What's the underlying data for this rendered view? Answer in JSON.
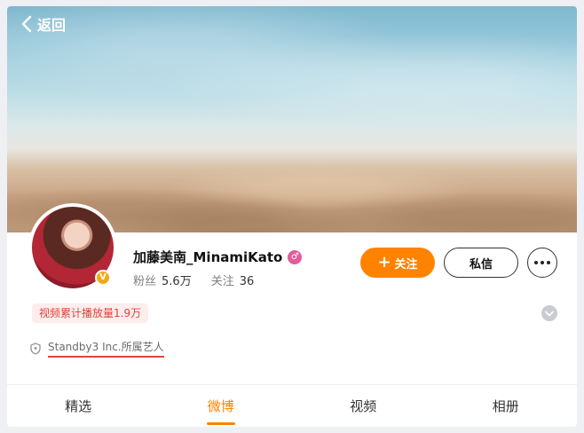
{
  "nav": {
    "back_label": "返回"
  },
  "profile": {
    "name": "加藤美南_MinamiKato",
    "verified_badge": "V",
    "member_badge": "♂",
    "stats": [
      {
        "key": "粉丝",
        "value": "5.6万"
      },
      {
        "key": "关注",
        "value": "36"
      }
    ],
    "play_count_badge": "视频累计播放量1.9万",
    "organization": "Standby3 Inc.所属艺人"
  },
  "actions": {
    "follow_plus": "+",
    "follow_label": "关注",
    "message_label": "私信"
  },
  "tabs": [
    {
      "label": "精选"
    },
    {
      "label": "微博"
    },
    {
      "label": "视频"
    },
    {
      "label": "相册"
    }
  ],
  "active_tab_index": 1,
  "colors": {
    "accent": "#ff8200",
    "badge_text": "#e3403a",
    "underline": "#e1433b",
    "verified": "#f2a91c",
    "member": "#e65a9a"
  },
  "icons": {
    "back": "chevron-left-icon",
    "more": "more-dots-icon",
    "expand": "chevron-down-icon",
    "org": "shield-icon"
  }
}
